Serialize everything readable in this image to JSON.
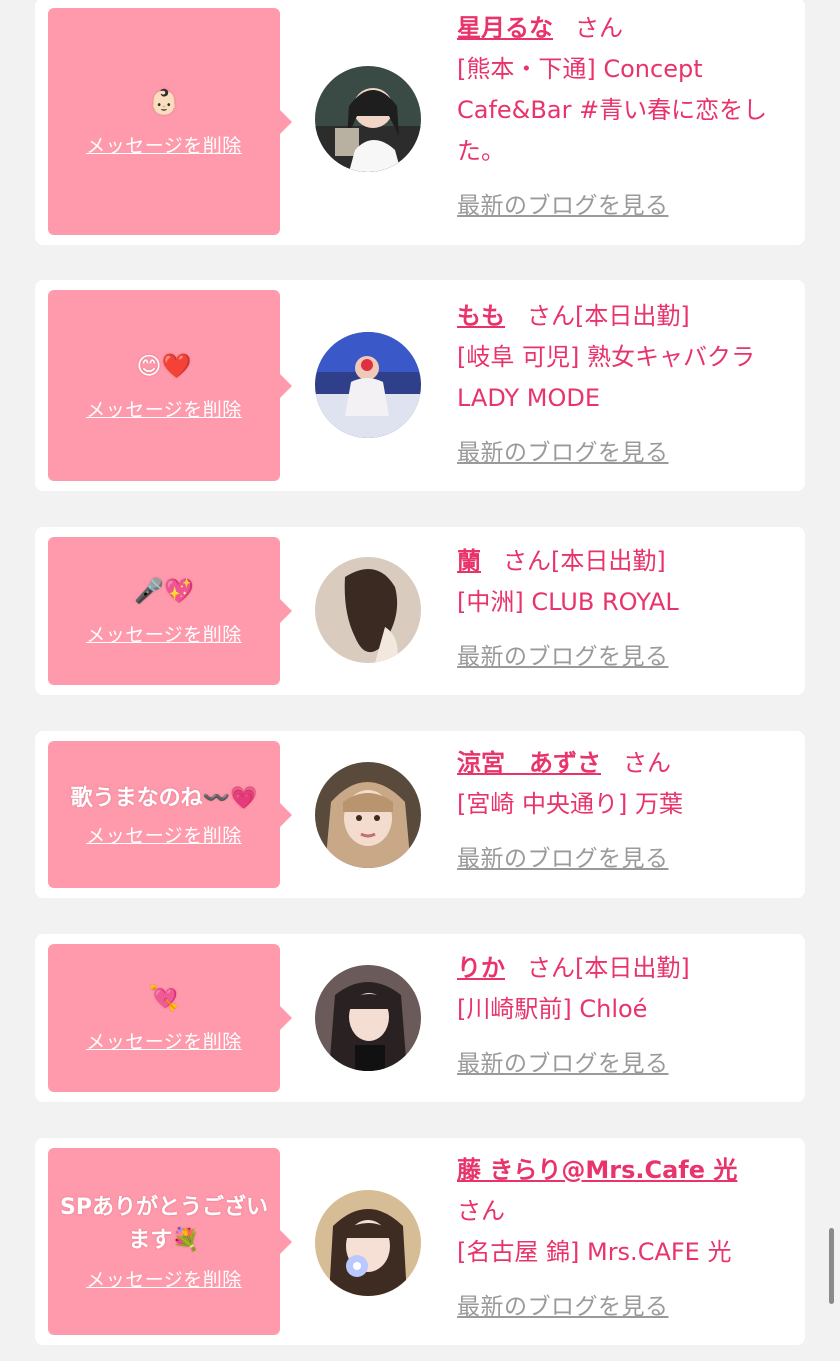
{
  "cards": [
    {
      "message": "👶🏻",
      "delete_label": "メッセージを削除",
      "name": "星月るな",
      "honorific": "さん",
      "status": "",
      "shop": "[熊本・下通] Concept Cafe&Bar #青い春に恋をした。",
      "blog_label": "最新のブログを見る"
    },
    {
      "message": "😊❤️",
      "delete_label": "メッセージを削除",
      "name": "もも",
      "honorific": "さん",
      "status": "[本日出勤]",
      "shop": "[岐阜 可児] 熟女キャバクラ LADY MODE",
      "blog_label": "最新のブログを見る"
    },
    {
      "message": "🎤💖",
      "delete_label": "メッセージを削除",
      "name": "蘭",
      "honorific": "さん",
      "status": "[本日出勤]",
      "shop": "[中洲] CLUB ROYAL",
      "blog_label": "最新のブログを見る"
    },
    {
      "message": "歌うまなのね〰️💗",
      "delete_label": "メッセージを削除",
      "name": "涼宮　あずさ",
      "honorific": "さん",
      "status": "",
      "shop": "[宮崎 中央通り] 万葉",
      "blog_label": "最新のブログを見る"
    },
    {
      "message": "💘",
      "delete_label": "メッセージを削除",
      "name": "りか",
      "honorific": "さん",
      "status": "[本日出勤]",
      "shop": "[川崎駅前] Chloé",
      "blog_label": "最新のブログを見る"
    },
    {
      "message": "SPありがとうございます💐",
      "delete_label": "メッセージを削除",
      "name": "藤 きらり@Mrs.Cafe 光",
      "honorific": "さん",
      "status": "",
      "shop": "[名古屋 錦] Mrs.CAFE 光",
      "blog_label": "最新のブログを見る"
    }
  ],
  "colors": {
    "accent": "#e8336b",
    "bubble": "#ff9aac",
    "background": "#f2f2f2",
    "link_gray": "#9a9a9a"
  }
}
